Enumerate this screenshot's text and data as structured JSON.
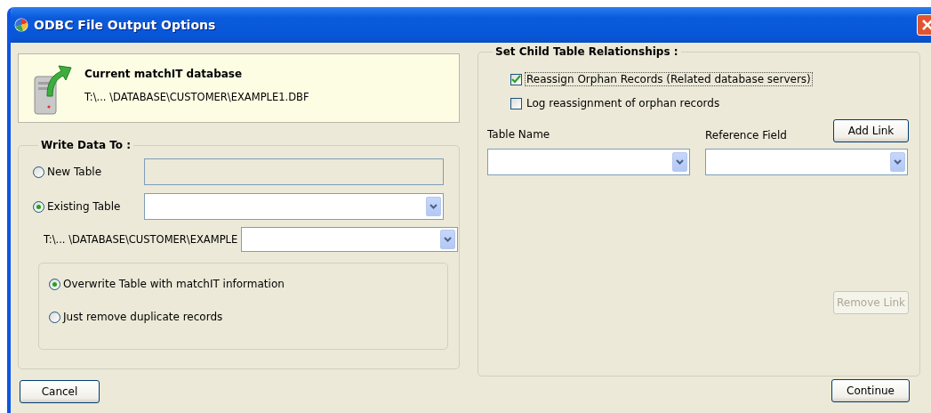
{
  "window": {
    "title": "ODBC File Output Options"
  },
  "current_database": {
    "heading": "Current matchIT database",
    "path": "T:\\... \\DATABASE\\CUSTOMER\\EXAMPLE1.DBF"
  },
  "write_data_to": {
    "title": "Write Data To :",
    "targets": [
      {
        "label": "New Table",
        "selected": false,
        "kind": "textbox",
        "disabled": true
      },
      {
        "label": "Existing Table",
        "selected": true,
        "kind": "dropdown",
        "disabled": false
      }
    ],
    "folder_path": "T:\\... \\DATABASE\\CUSTOMER\\EXAMPLE",
    "modes": [
      {
        "label": "Overwrite Table with matchIT information",
        "selected": true
      },
      {
        "label": "Just remove duplicate records",
        "selected": false
      }
    ]
  },
  "child_relationships": {
    "title": "Set Child Table Relationships :",
    "checkboxes": [
      {
        "label": "Reassign Orphan Records (Related database servers)",
        "checked": true,
        "focused": true
      },
      {
        "label": "Log reassignment of orphan records",
        "checked": false,
        "focused": false
      }
    ],
    "table_name_label": "Table Name",
    "reference_field_label": "Reference Field",
    "add_button": {
      "label": "Add Link",
      "disabled": false
    },
    "remove_button": {
      "label": "Remove Link",
      "disabled": true
    }
  },
  "buttons": [
    {
      "label": "Cancel"
    },
    {
      "label": "Continue"
    }
  ]
}
